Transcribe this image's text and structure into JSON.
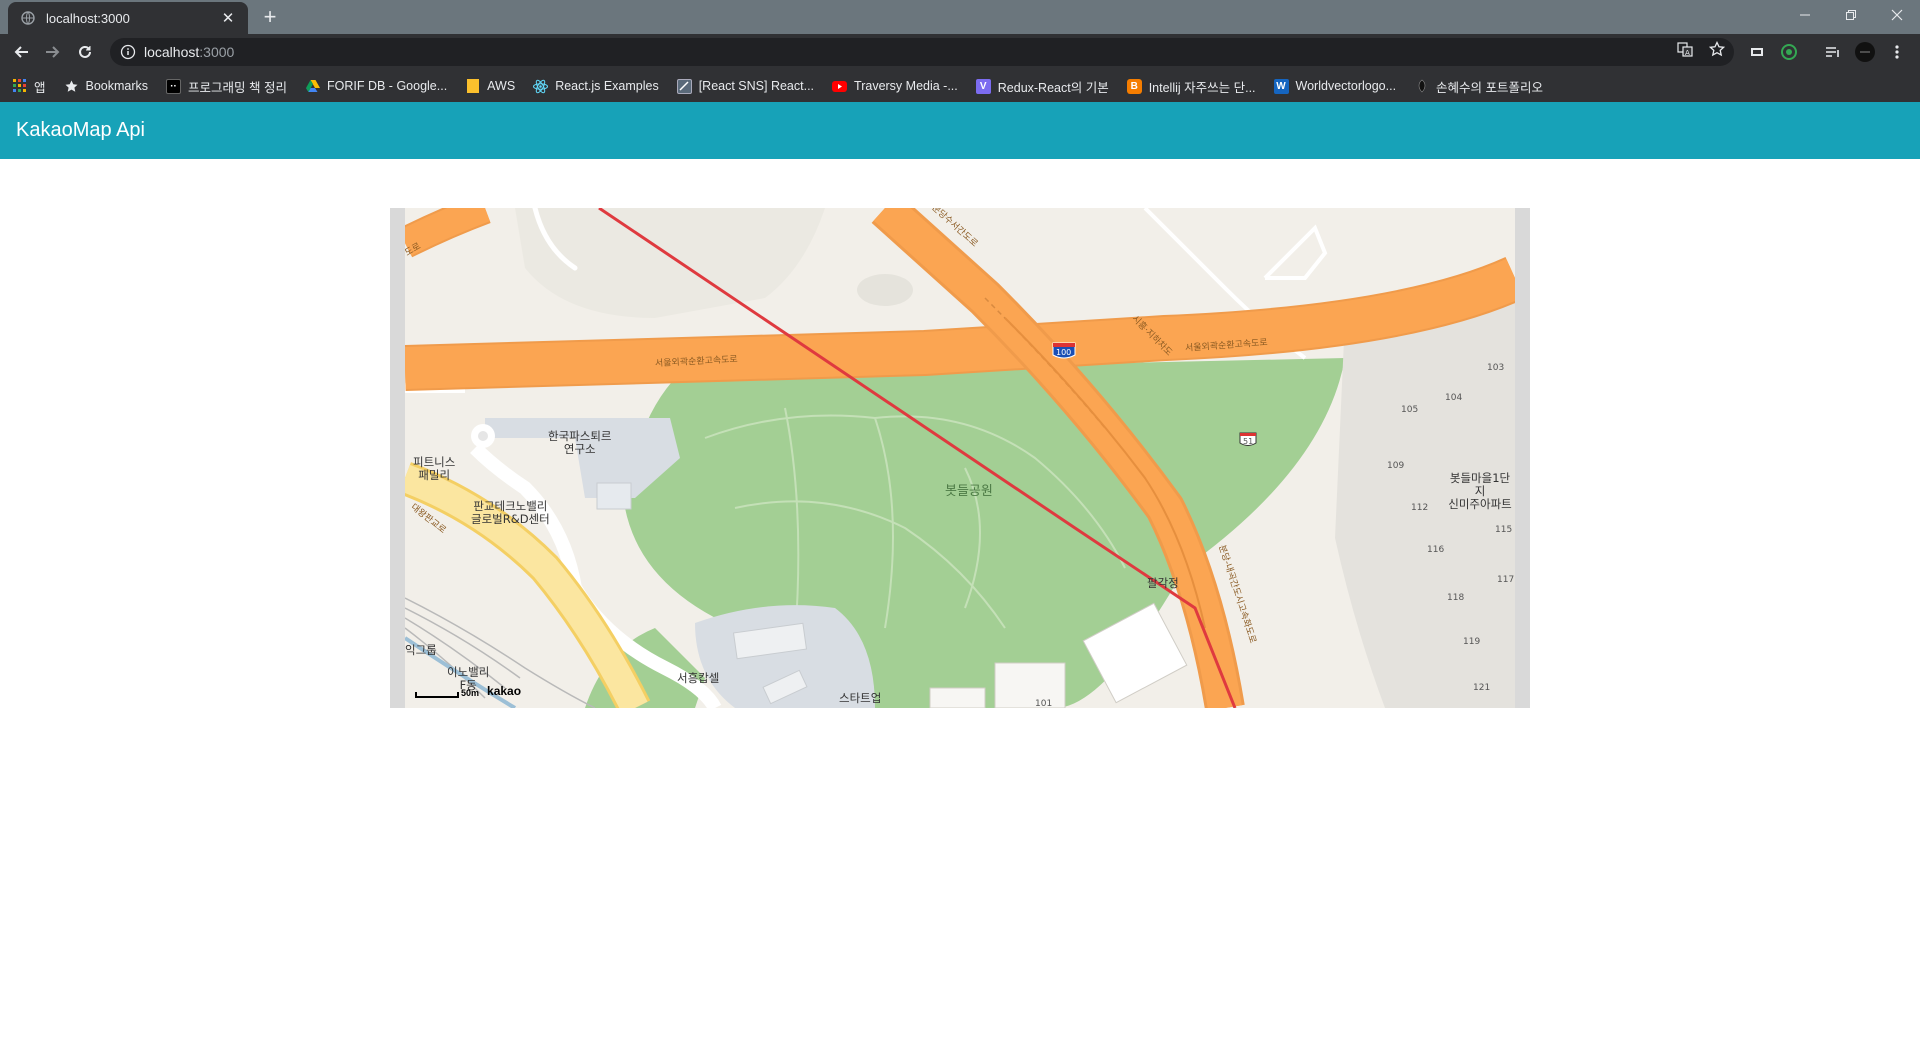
{
  "browser": {
    "tab": {
      "title": "localhost:3000",
      "favicon": "globe-icon"
    },
    "url": {
      "host": "localhost",
      "port": ":3000"
    },
    "window_controls": [
      "minimize-icon",
      "restore-icon",
      "close-icon"
    ]
  },
  "bookmarks": [
    {
      "label": "앱",
      "icon": "apps-grid-icon",
      "color": "#f4b400"
    },
    {
      "label": "Bookmarks",
      "icon": "star-icon",
      "color": "#e8eaed"
    },
    {
      "label": "프로그래밍 책 정리",
      "icon": "notion-icon",
      "color": "#000000"
    },
    {
      "label": "FORIF DB - Google...",
      "icon": "google-drive-icon",
      "color": "#0f9d58"
    },
    {
      "label": "AWS",
      "icon": "folder-icon",
      "color": "#fbc02d"
    },
    {
      "label": "React.js Examples",
      "icon": "react-icon",
      "color": "#61dafb"
    },
    {
      "label": "[React SNS] React...",
      "icon": "site-icon",
      "color": "#7a8a9a"
    },
    {
      "label": "Traversy Media -...",
      "icon": "youtube-icon",
      "color": "#ff0000"
    },
    {
      "label": "Redux-React의 기본",
      "icon": "velog-icon",
      "color": "#7c6cf0"
    },
    {
      "label": "Intellij 자주쓰는 단...",
      "icon": "blogger-icon",
      "color": "#f57d00"
    },
    {
      "label": "Worldvectorlogo...",
      "icon": "w-logo-icon",
      "color": "#1565c0"
    },
    {
      "label": "손혜수의 포트폴리오",
      "icon": "leaf-icon",
      "color": "#222222"
    }
  ],
  "navbar": {
    "brand": "KakaoMap Api"
  },
  "map": {
    "labels": {
      "expressway_left": "서울외곽순환고속도로",
      "expressway_right": "서울외곽순환고속도로",
      "tunnel": "시흥·지하차도",
      "road_corner": "도로",
      "road_right": "분당-내곡간도시고속화도로",
      "road_top": "분당수서간도로",
      "road_yellow": "대왕판교로",
      "shield_100": "100",
      "shield_51": "51",
      "pasteur": "한국파스퇴르\n연구소",
      "fitness": "피트니스\n패밀리",
      "techno": "판교테크노밸리\n글로벌R&D센터",
      "park": "봇들공원",
      "pavilion": "팔각정",
      "apt": "봇들마을1단지\n신미주아파트",
      "group": "익그룹",
      "innovalley": "이노밸리\nF동",
      "seoheung": "서흥캅셀",
      "startup": "스타트업",
      "b103": "103",
      "b104": "104",
      "b105": "105",
      "b109": "109",
      "b112": "112",
      "b115": "115",
      "b116": "116",
      "b117": "117",
      "b118": "118",
      "b119": "119",
      "b121": "121",
      "b101": "101"
    },
    "scale": {
      "distance": "50m",
      "logo": "kakao"
    }
  }
}
